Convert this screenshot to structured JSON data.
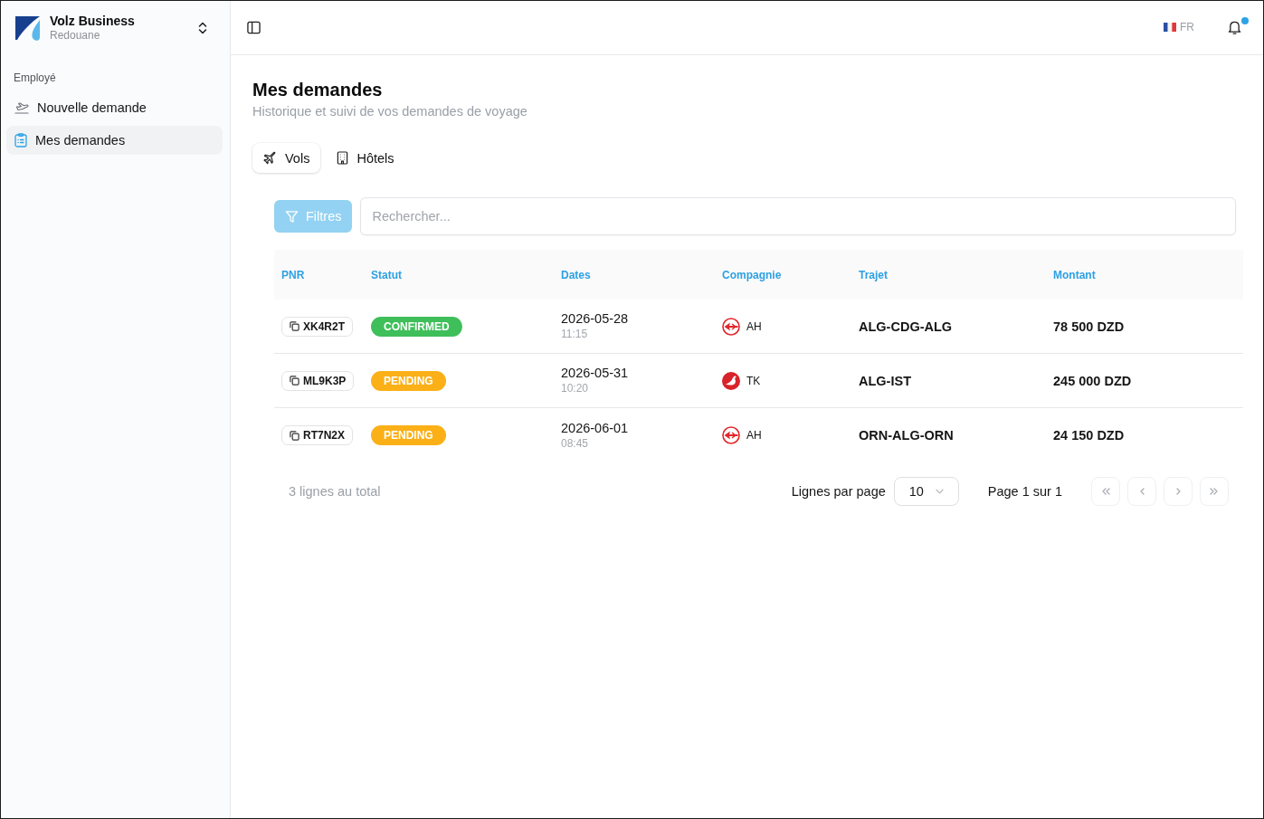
{
  "sidebar": {
    "workspace": {
      "name": "Volz Business",
      "user": "Redouane"
    },
    "section_label": "Employé",
    "items": [
      {
        "label": "Nouvelle demande",
        "kind": "new",
        "selected": false
      },
      {
        "label": "Mes demandes",
        "kind": "list",
        "selected": true
      }
    ]
  },
  "header": {
    "language": "FR",
    "notifications": {
      "unread": true
    }
  },
  "page": {
    "title": "Mes demandes",
    "subtitle": "Historique et suivi de vos demandes de voyage"
  },
  "tabs": [
    {
      "label": "Vols",
      "kind": "flights",
      "selected": true
    },
    {
      "label": "Hôtels",
      "kind": "hotels",
      "selected": false
    }
  ],
  "toolbar": {
    "filter_button": "Filtres",
    "search": {
      "placeholder": "Rechercher..."
    }
  },
  "table": {
    "columns": [
      "PNR",
      "Statut",
      "Dates",
      "Compagnie",
      "Trajet",
      "Montant"
    ],
    "rows": [
      {
        "pnr": "XK4R2T",
        "status": {
          "label": "CONFIRMED",
          "color": "#3fbf5a"
        },
        "date": "2026-05-28",
        "time": "11:15",
        "airline": {
          "code": "AH",
          "kind": "ring"
        },
        "route": "ALG-CDG-ALG",
        "amount": "78 500 DZD"
      },
      {
        "pnr": "ML9K3P",
        "status": {
          "label": "PENDING",
          "color": "#fbb017"
        },
        "date": "2026-05-31",
        "time": "10:20",
        "airline": {
          "code": "TK",
          "kind": "disc"
        },
        "route": "ALG-IST",
        "amount": "245 000 DZD"
      },
      {
        "pnr": "RT7N2X",
        "status": {
          "label": "PENDING",
          "color": "#fbb017"
        },
        "date": "2026-06-01",
        "time": "08:45",
        "airline": {
          "code": "AH",
          "kind": "ring"
        },
        "route": "ORN-ALG-ORN",
        "amount": "24 150 DZD"
      }
    ]
  },
  "footer": {
    "total": "3 lignes au total",
    "rows_per_page_label": "Lignes par page",
    "rows_per_page": "10",
    "page_info": "Page 1 sur 1",
    "nav_buttons": [
      {
        "kind": "first",
        "disabled": true
      },
      {
        "kind": "previous",
        "disabled": true
      },
      {
        "kind": "next",
        "disabled": true
      },
      {
        "kind": "last",
        "disabled": true
      }
    ]
  }
}
